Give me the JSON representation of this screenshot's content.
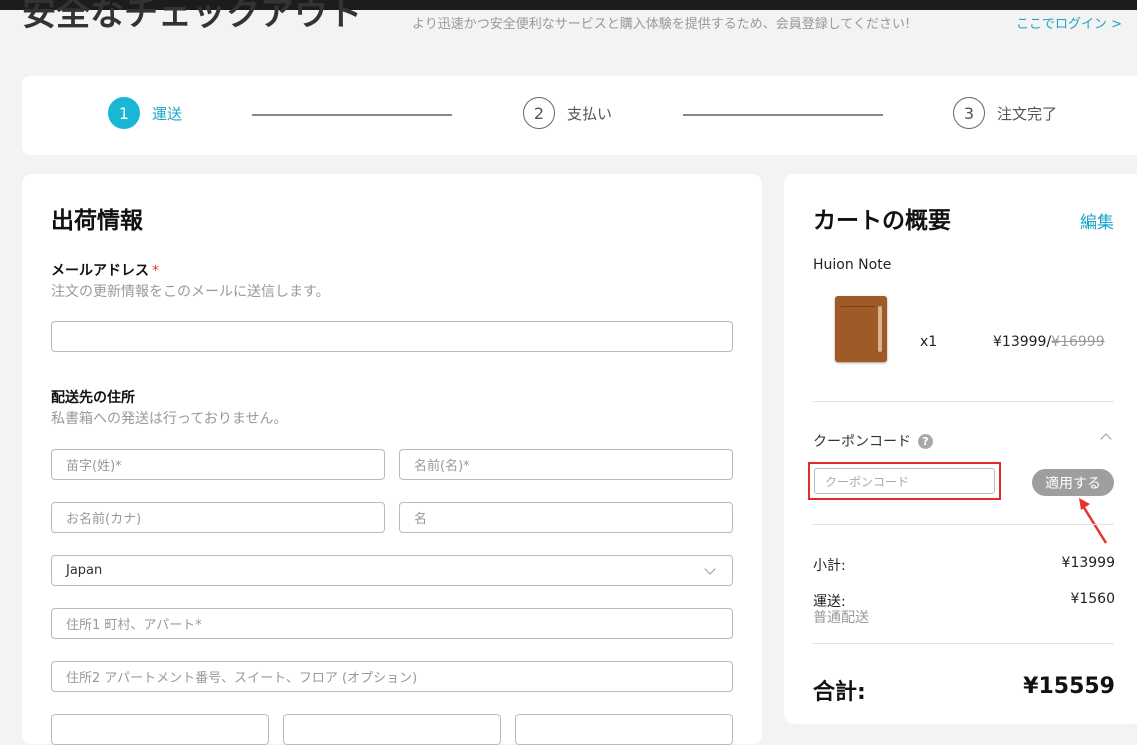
{
  "header": {
    "title": "安全なチェックアウト",
    "register_note": "より迅速かつ安全便利なサービスと購入体験を提供するため、会員登録してください!",
    "login_link": "ここでログイン >"
  },
  "steps": [
    {
      "number": "1",
      "label": "運送",
      "active": true
    },
    {
      "number": "2",
      "label": "支払い",
      "active": false
    },
    {
      "number": "3",
      "label": "注文完了",
      "active": false
    }
  ],
  "shipping": {
    "title": "出荷情報",
    "email_label": "メールアドレス",
    "required_mark": "*",
    "email_hint": "注文の更新情報をこのメールに送信します。",
    "email_value": "",
    "address_label": "配送先の住所",
    "address_hint": "私書箱への発送は行っておりません。",
    "last_name_placeholder": "苗字(姓)*",
    "first_name_placeholder": "名前(名)*",
    "kana_last_placeholder": "お名前(カナ)",
    "kana_first_placeholder": "名",
    "country_value": "Japan",
    "address1_placeholder": "住所1 町村、アパート*",
    "address2_placeholder": "住所2 アパートメント番号、スイート、フロア (オプション)"
  },
  "cart": {
    "title": "カートの概要",
    "edit_label": "編集",
    "product_name": "Huion Note",
    "quantity": "x1",
    "price": "¥13999/",
    "original_price": "¥16999",
    "coupon_label": "クーポンコード",
    "help_icon_glyph": "?",
    "coupon_placeholder": "クーポンコード",
    "apply_label": "適用する",
    "subtotal_label": "小計:",
    "subtotal_value": "¥13999",
    "shipping_label": "運送:",
    "shipping_value": "¥1560",
    "shipping_method": "普通配送",
    "total_label": "合計:",
    "total_value": "¥15559"
  },
  "colors": {
    "accent": "#19b6d6",
    "link": "#19a6c7",
    "highlight_border": "#e22b2b",
    "arrow": "#e8322f"
  }
}
